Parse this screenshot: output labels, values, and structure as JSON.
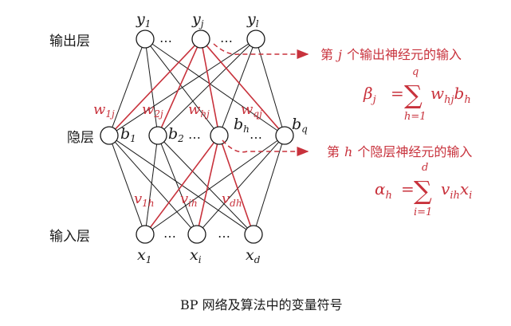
{
  "layers": {
    "output": "输出层",
    "hidden": "隐层",
    "input": "输入层"
  },
  "output_nodes": [
    "y",
    "y",
    "y"
  ],
  "output_subs": [
    "1",
    "j",
    "l"
  ],
  "hidden_nodes": [
    "b",
    "b",
    "b",
    "b"
  ],
  "hidden_subs": [
    "1",
    "2",
    "h",
    "q"
  ],
  "input_nodes": [
    "x",
    "x",
    "x"
  ],
  "input_subs": [
    "1",
    "i",
    "d"
  ],
  "ellipsis": "⋯",
  "weights_hidden_output": [
    {
      "base": "w",
      "sub": "1j"
    },
    {
      "base": "w",
      "sub": "2j"
    },
    {
      "base": "w",
      "sub": "hj"
    },
    {
      "base": "w",
      "sub": "qj"
    }
  ],
  "weights_input_hidden": [
    {
      "base": "v",
      "sub": "1h"
    },
    {
      "base": "v",
      "sub": "ih"
    },
    {
      "base": "v",
      "sub": "dh"
    }
  ],
  "annotation_output": {
    "text_pre": "第",
    "var": "j",
    "text_post": "个输出神经元的输入",
    "lhs": "β",
    "lhs_sub": "j",
    "eq": "=",
    "sum": "∑",
    "upper": "q",
    "lower": "h=1",
    "term1": "w",
    "term1_sub": "hj",
    "term2": "b",
    "term2_sub": "h"
  },
  "annotation_hidden": {
    "text_pre": "第",
    "var": "h",
    "text_post": "个隐层神经元的输入",
    "lhs": "α",
    "lhs_sub": "h",
    "eq": "=",
    "sum": "∑",
    "upper": "d",
    "lower": "i=1",
    "term1": "v",
    "term1_sub": "ih",
    "term2": "x",
    "term2_sub": "i"
  },
  "caption": "BP 网络及算法中的变量符号",
  "colors": {
    "red": "#c8323c",
    "black": "#1a1a1a"
  }
}
